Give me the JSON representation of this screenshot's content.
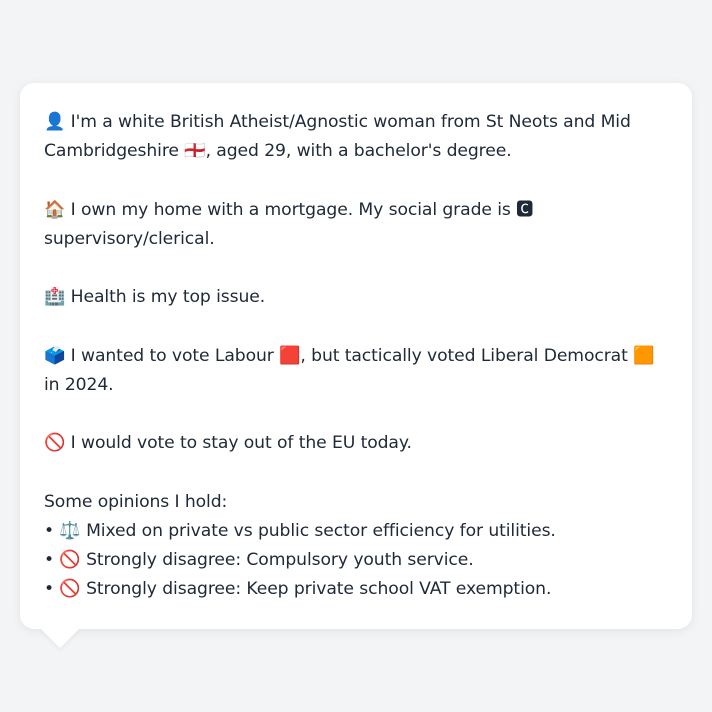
{
  "message": {
    "identity": "👤 I'm a white British Atheist/Agnostic woman from St Neots and Mid Cambridgeshire 🏴󠁧󠁢󠁥󠁮󠁧󠁿, aged 29, with a bachelor's degree.",
    "housing": "🏠 I own my home with a mortgage. My social grade is 🅲 supervisory/clerical.",
    "top_issue": "🏥 Health is my top issue.",
    "vote_2024": "🗳️ I wanted to vote Labour 🟥, but tactically voted Liberal Democrat 🟧 in 2024.",
    "eu": "🚫 I would vote to stay out of the EU today.",
    "opinions_heading": "Some opinions I hold:",
    "opinions": [
      "• ⚖️ Mixed on private vs public sector efficiency for utilities.",
      "• 🚫 Strongly disagree: Compulsory youth service.",
      "• 🚫 Strongly disagree: Keep private school VAT exemption."
    ]
  }
}
